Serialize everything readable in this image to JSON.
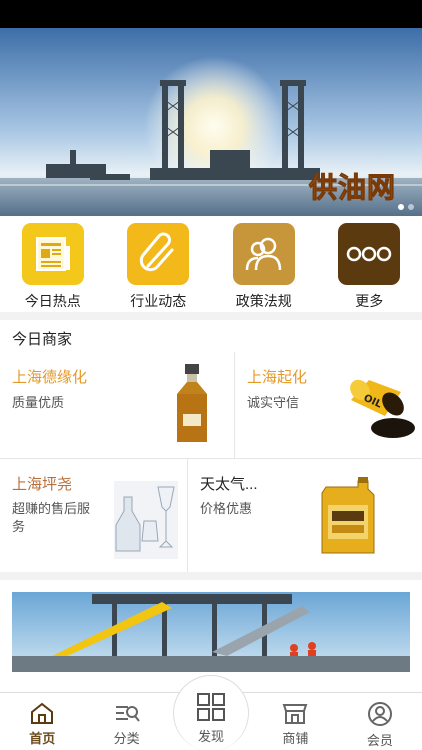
{
  "banner": {
    "logo_text": "供油网",
    "slide_count": 2,
    "active_slide": 1
  },
  "quick_nav": [
    {
      "label": "今日热点",
      "icon": "newspaper-icon",
      "color": "#f3c81b"
    },
    {
      "label": "行业动态",
      "icon": "paperclip-icon",
      "color": "#f3b91b"
    },
    {
      "label": "政策法规",
      "icon": "users-icon",
      "color": "#c8963a"
    },
    {
      "label": "更多",
      "icon": "more-icon",
      "color": "#5b3a10"
    }
  ],
  "merchants": {
    "title": "今日商家",
    "items": [
      {
        "name": "上海德缘化",
        "desc": "质量优质",
        "name_color": "#e39a2a",
        "image": "oil-bottle"
      },
      {
        "name": "上海起化",
        "desc": "诚实守信",
        "name_color": "#e39a2a",
        "image": "oil-barrel"
      },
      {
        "name": "上海坪尧",
        "desc": "超赚的售后服务",
        "name_color": "#b8703a",
        "image": "glassware"
      },
      {
        "name": "天太气...",
        "desc": "价格优惠",
        "name_color": "#222222",
        "image": "oil-can"
      }
    ]
  },
  "tabbar": {
    "items": [
      {
        "label": "首页",
        "icon": "home-icon",
        "active": true
      },
      {
        "label": "分类",
        "icon": "category-icon",
        "active": false
      },
      {
        "label": "发现",
        "icon": "grid-icon",
        "active": false
      },
      {
        "label": "商铺",
        "icon": "shop-icon",
        "active": false
      },
      {
        "label": "会员",
        "icon": "member-icon",
        "active": false
      }
    ]
  }
}
